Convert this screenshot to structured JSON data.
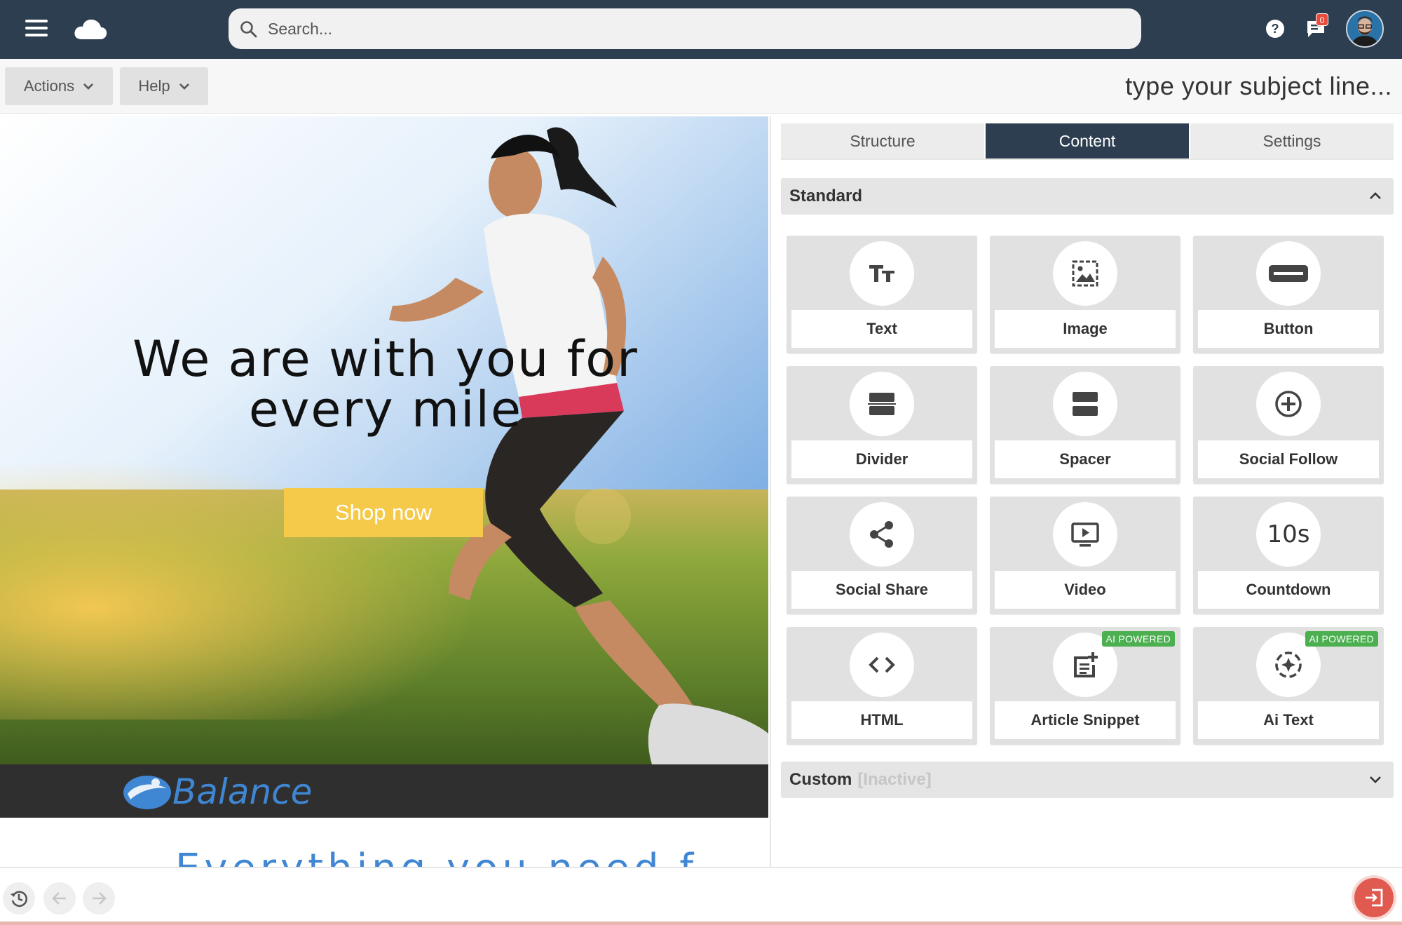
{
  "topbar": {
    "search_placeholder": "Search...",
    "notification_count": "0",
    "icons": [
      "menu-icon",
      "cloud-logo-icon",
      "search-icon",
      "help-icon",
      "chat-icon",
      "avatar"
    ]
  },
  "toolbar": {
    "actions_label": "Actions",
    "help_label": "Help",
    "subject_line": "type your subject line..."
  },
  "canvas": {
    "hero_heading": "We are with you for every mile",
    "shop_button": "Shop now",
    "brand_name": "Balance",
    "partial_text": "Everything you need f",
    "colors": {
      "button": "#f5c94a",
      "brand": "#3f86d3",
      "brandbar": "#2f2f2f"
    }
  },
  "panel": {
    "tabs": [
      {
        "label": "Structure",
        "active": false
      },
      {
        "label": "Content",
        "active": true
      },
      {
        "label": "Settings",
        "active": false
      }
    ],
    "standard_title": "Standard",
    "custom_title": "Custom",
    "custom_status": "[Inactive]",
    "tiles": [
      {
        "label": "Text",
        "icon": "text-icon"
      },
      {
        "label": "Image",
        "icon": "image-icon"
      },
      {
        "label": "Button",
        "icon": "button-icon"
      },
      {
        "label": "Divider",
        "icon": "divider-icon"
      },
      {
        "label": "Spacer",
        "icon": "spacer-icon"
      },
      {
        "label": "Social Follow",
        "icon": "plus-circle-icon"
      },
      {
        "label": "Social Share",
        "icon": "share-icon"
      },
      {
        "label": "Video",
        "icon": "video-icon"
      },
      {
        "label": "Countdown",
        "icon_text": "10s"
      },
      {
        "label": "HTML",
        "icon": "code-icon"
      },
      {
        "label": "Article Snippet",
        "icon": "article-icon",
        "badge": "AI POWERED"
      },
      {
        "label": "Ai Text",
        "icon": "ai-sparkle-icon",
        "badge": "AI POWERED"
      }
    ],
    "colors": {
      "active_tab": "#2d3e50",
      "badge": "#4caf50"
    }
  },
  "bottombar": {
    "icons": [
      "history-icon",
      "undo-icon",
      "redo-icon",
      "exit-icon"
    ]
  }
}
